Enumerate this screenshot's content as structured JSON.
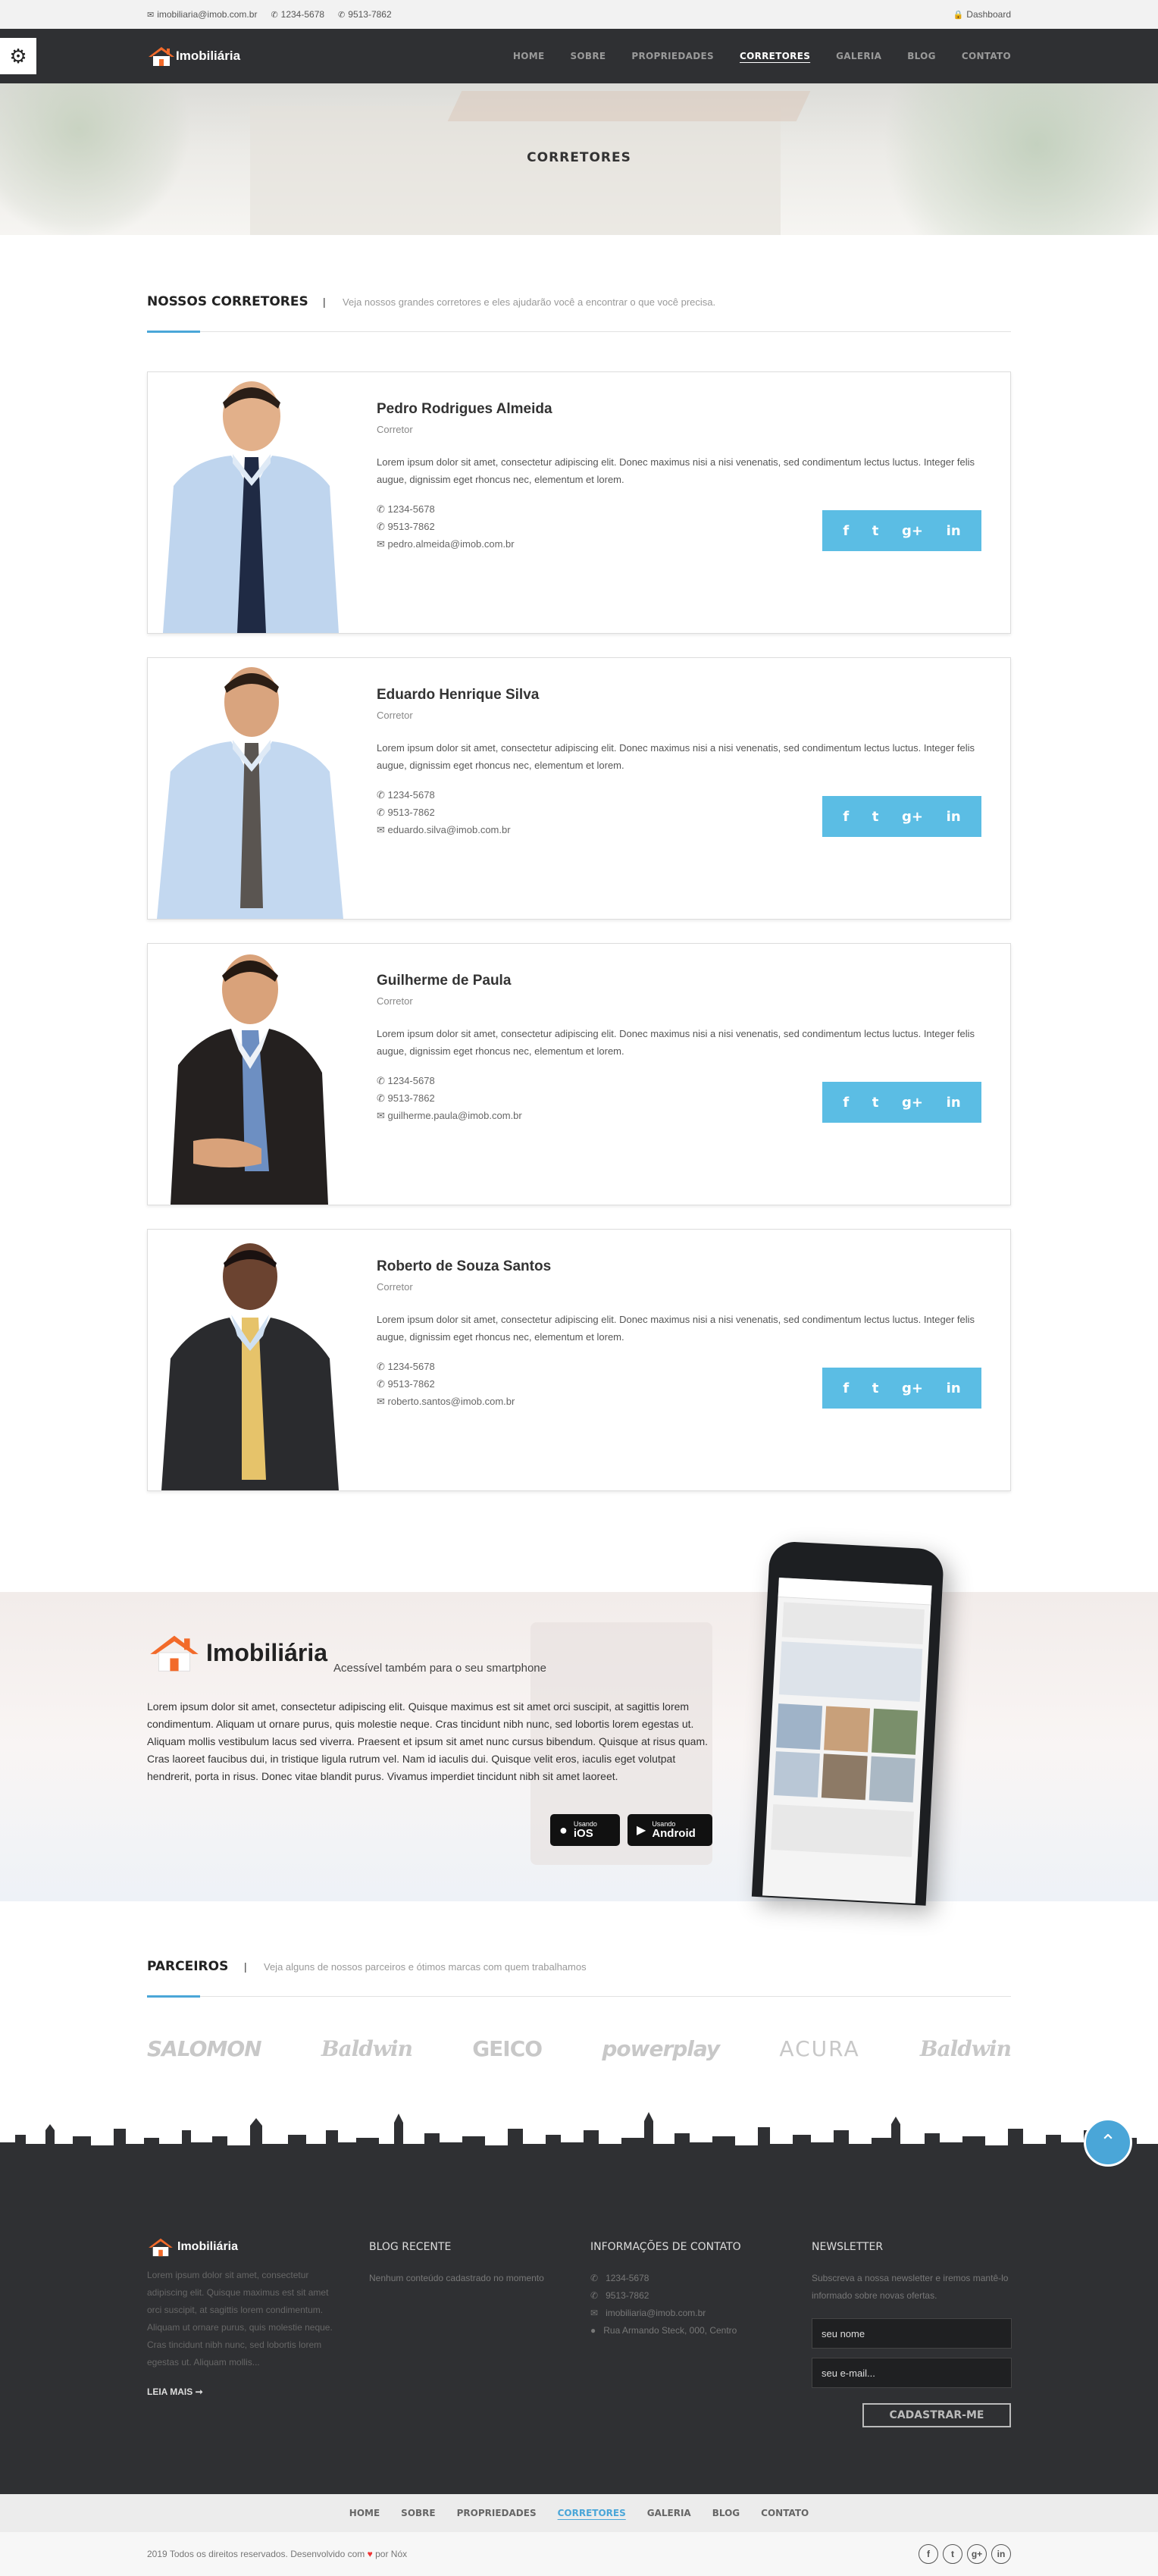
{
  "topbar": {
    "email": "imobiliaria@imob.com.br",
    "phone1": "1234-5678",
    "phone2": "9513-7862",
    "dashboard": "Dashboard"
  },
  "brand": {
    "name": "Imobiliária"
  },
  "nav": [
    "HOME",
    "SOBRE",
    "PROPRIEDADES",
    "CORRETORES",
    "GALERIA",
    "BLOG",
    "CONTATO"
  ],
  "nav_active": "CORRETORES",
  "hero": {
    "title": "CORRETORES"
  },
  "agents_section": {
    "title": "NOSSOS CORRETORES",
    "separator": "|",
    "subtitle": "Veja nossos grandes corretores e eles ajudarão você a encontrar o que você precisa."
  },
  "agents": [
    {
      "name": "Pedro Rodrigues Almeida",
      "role": "Corretor",
      "desc": "Lorem ipsum dolor sit amet, consectetur adipiscing elit. Donec maximus nisi a nisi venenatis, sed condimentum lectus luctus. Integer felis augue, dignissim eget rhoncus nec, elementum et lorem.",
      "phone1": "1234-5678",
      "phone2": "9513-7862",
      "email": "pedro.almeida@imob.com.br"
    },
    {
      "name": "Eduardo Henrique Silva",
      "role": "Corretor",
      "desc": "Lorem ipsum dolor sit amet, consectetur adipiscing elit. Donec maximus nisi a nisi venenatis, sed condimentum lectus luctus. Integer felis augue, dignissim eget rhoncus nec, elementum et lorem.",
      "phone1": "1234-5678",
      "phone2": "9513-7862",
      "email": "eduardo.silva@imob.com.br"
    },
    {
      "name": "Guilherme de Paula",
      "role": "Corretor",
      "desc": "Lorem ipsum dolor sit amet, consectetur adipiscing elit. Donec maximus nisi a nisi venenatis, sed condimentum lectus luctus. Integer felis augue, dignissim eget rhoncus nec, elementum et lorem.",
      "phone1": "1234-5678",
      "phone2": "9513-7862",
      "email": "guilherme.paula@imob.com.br"
    },
    {
      "name": "Roberto de Souza Santos",
      "role": "Corretor",
      "desc": "Lorem ipsum dolor sit amet, consectetur adipiscing elit. Donec maximus nisi a nisi venenatis, sed condimentum lectus luctus. Integer felis augue, dignissim eget rhoncus nec, elementum et lorem.",
      "phone1": "1234-5678",
      "phone2": "9513-7862",
      "email": "roberto.santos@imob.com.br"
    }
  ],
  "social": {
    "facebook": "f",
    "twitter": "t",
    "googleplus": "g+",
    "linkedin": "in"
  },
  "promo": {
    "tagline": "Acessível também para o seu smartphone",
    "text": "Lorem ipsum dolor sit amet, consectetur adipiscing elit. Quisque maximus est sit amet orci suscipit, at sagittis lorem condimentum. Aliquam ut ornare purus, quis molestie neque. Cras tincidunt nibh nunc, sed lobortis lorem egestas ut. Aliquam mollis vestibulum lacus sed viverra. Praesent et ipsum sit amet nunc cursus bibendum. Quisque at risus quam. Cras laoreet faucibus dui, in tristique ligula rutrum vel. Nam id iaculis dui. Quisque velit eros, iaculis eget volutpat hendrerit, porta in risus. Donec vitae blandit purus. Vivamus imperdiet tincidunt nibh sit amet laoreet.",
    "ios_small": "Usando",
    "ios_big": "iOS",
    "android_small": "Usando",
    "android_big": "Android"
  },
  "partners_section": {
    "title": "PARCEIROS",
    "separator": "|",
    "subtitle": "Veja alguns de nossos parceiros e ótimos marcas com quem trabalhamos"
  },
  "partners": [
    "SALOMON",
    "Baldwin",
    "GEICO",
    "powerplay",
    "ACURA",
    "Baldwin"
  ],
  "footer": {
    "about": "Lorem ipsum dolor sit amet, consectetur adipiscing elit. Quisque maximus est sit amet orci suscipit, at sagittis lorem condimentum. Aliquam ut ornare purus, quis molestie neque. Cras tincidunt nibh nunc, sed lobortis lorem egestas ut. Aliquam mollis...",
    "read_more": "LEIA MAIS",
    "blog_title": "BLOG RECENTE",
    "blog_empty": "Nenhum conteúdo cadastrado no momento",
    "contact_title": "INFORMAÇÕES DE CONTATO",
    "contact_phone1": "1234-5678",
    "contact_phone2": "9513-7862",
    "contact_email": "imobiliaria@imob.com.br",
    "contact_address": "Rua Armando Steck, 000, Centro",
    "newsletter_title": "NEWSLETTER",
    "newsletter_text": "Subscreva a nossa newsletter e iremos mantê-lo informado sobre novas ofertas.",
    "name_placeholder": "seu nome",
    "email_placeholder": "seu e-mail...",
    "subscribe": "CADASTRAR-ME"
  },
  "copyright": {
    "text": "2019 Todos os direitos reservados. Desenvolvido com",
    "heart": "♥",
    "by": "por Nóx"
  },
  "colors": {
    "accent": "#4aa6d8",
    "social": "#5bbde4",
    "dark": "#2f3033"
  }
}
